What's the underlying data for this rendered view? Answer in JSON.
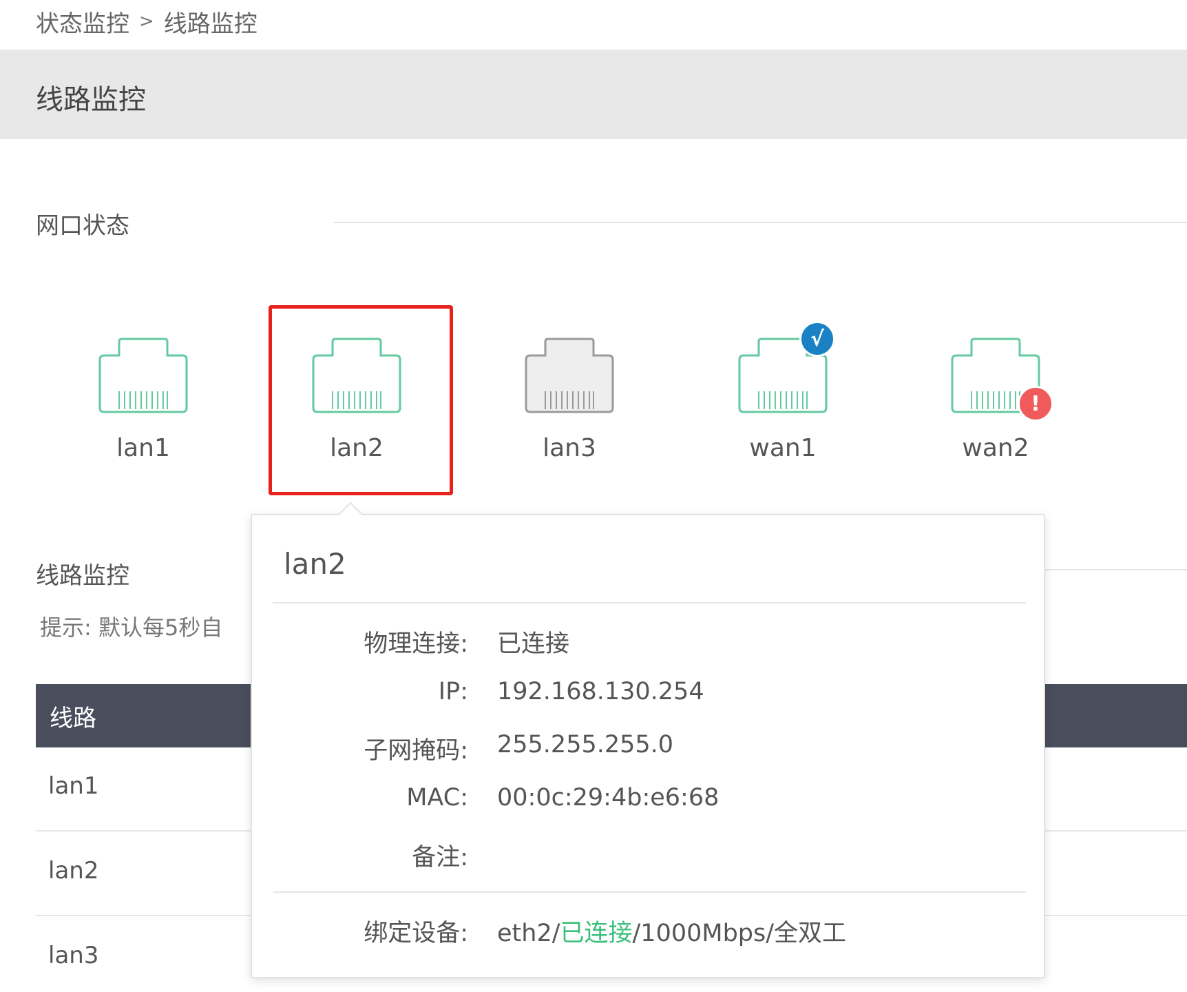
{
  "breadcrumb": {
    "parent": "状态监控",
    "separator": ">",
    "current": "线路监控"
  },
  "page_title": "线路监控",
  "section_ports": {
    "title": "网口状态"
  },
  "ports": [
    {
      "label": "lan1",
      "state": "connected",
      "badge": ""
    },
    {
      "label": "lan2",
      "state": "connected",
      "badge": "",
      "selected": true
    },
    {
      "label": "lan3",
      "state": "disconnected",
      "badge": ""
    },
    {
      "label": "wan1",
      "state": "connected",
      "badge": "√"
    },
    {
      "label": "wan2",
      "state": "connected",
      "badge": "!"
    }
  ],
  "section_lines": {
    "title": "线路监控",
    "hint": "提示: 默认每5秒自"
  },
  "table": {
    "header": "线路",
    "rows": [
      "lan1",
      "lan2",
      "lan3"
    ]
  },
  "popover": {
    "title": "lan2",
    "fields": {
      "physical_label": "物理连接:",
      "physical_value": "已连接",
      "ip_label": "IP:",
      "ip_value": "192.168.130.254",
      "mask_label": "子网掩码:",
      "mask_value": "255.255.255.0",
      "mac_label": "MAC:",
      "mac_value": "00:0c:29:4b:e6:68",
      "note_label": "备注:",
      "note_value": ""
    },
    "binding": {
      "label": "绑定设备:",
      "device": "eth2/",
      "status": "已连接",
      "speed": "/1000Mbps/全双工"
    }
  },
  "colors": {
    "connected": "#63c9a0",
    "disconnected": "#9a9a9a",
    "selection_border": "#e8221b",
    "badge_ok": "#1a82c4",
    "badge_error": "#f05a5a",
    "status_green": "#3cbf7a",
    "table_header": "#4a4e5c"
  }
}
